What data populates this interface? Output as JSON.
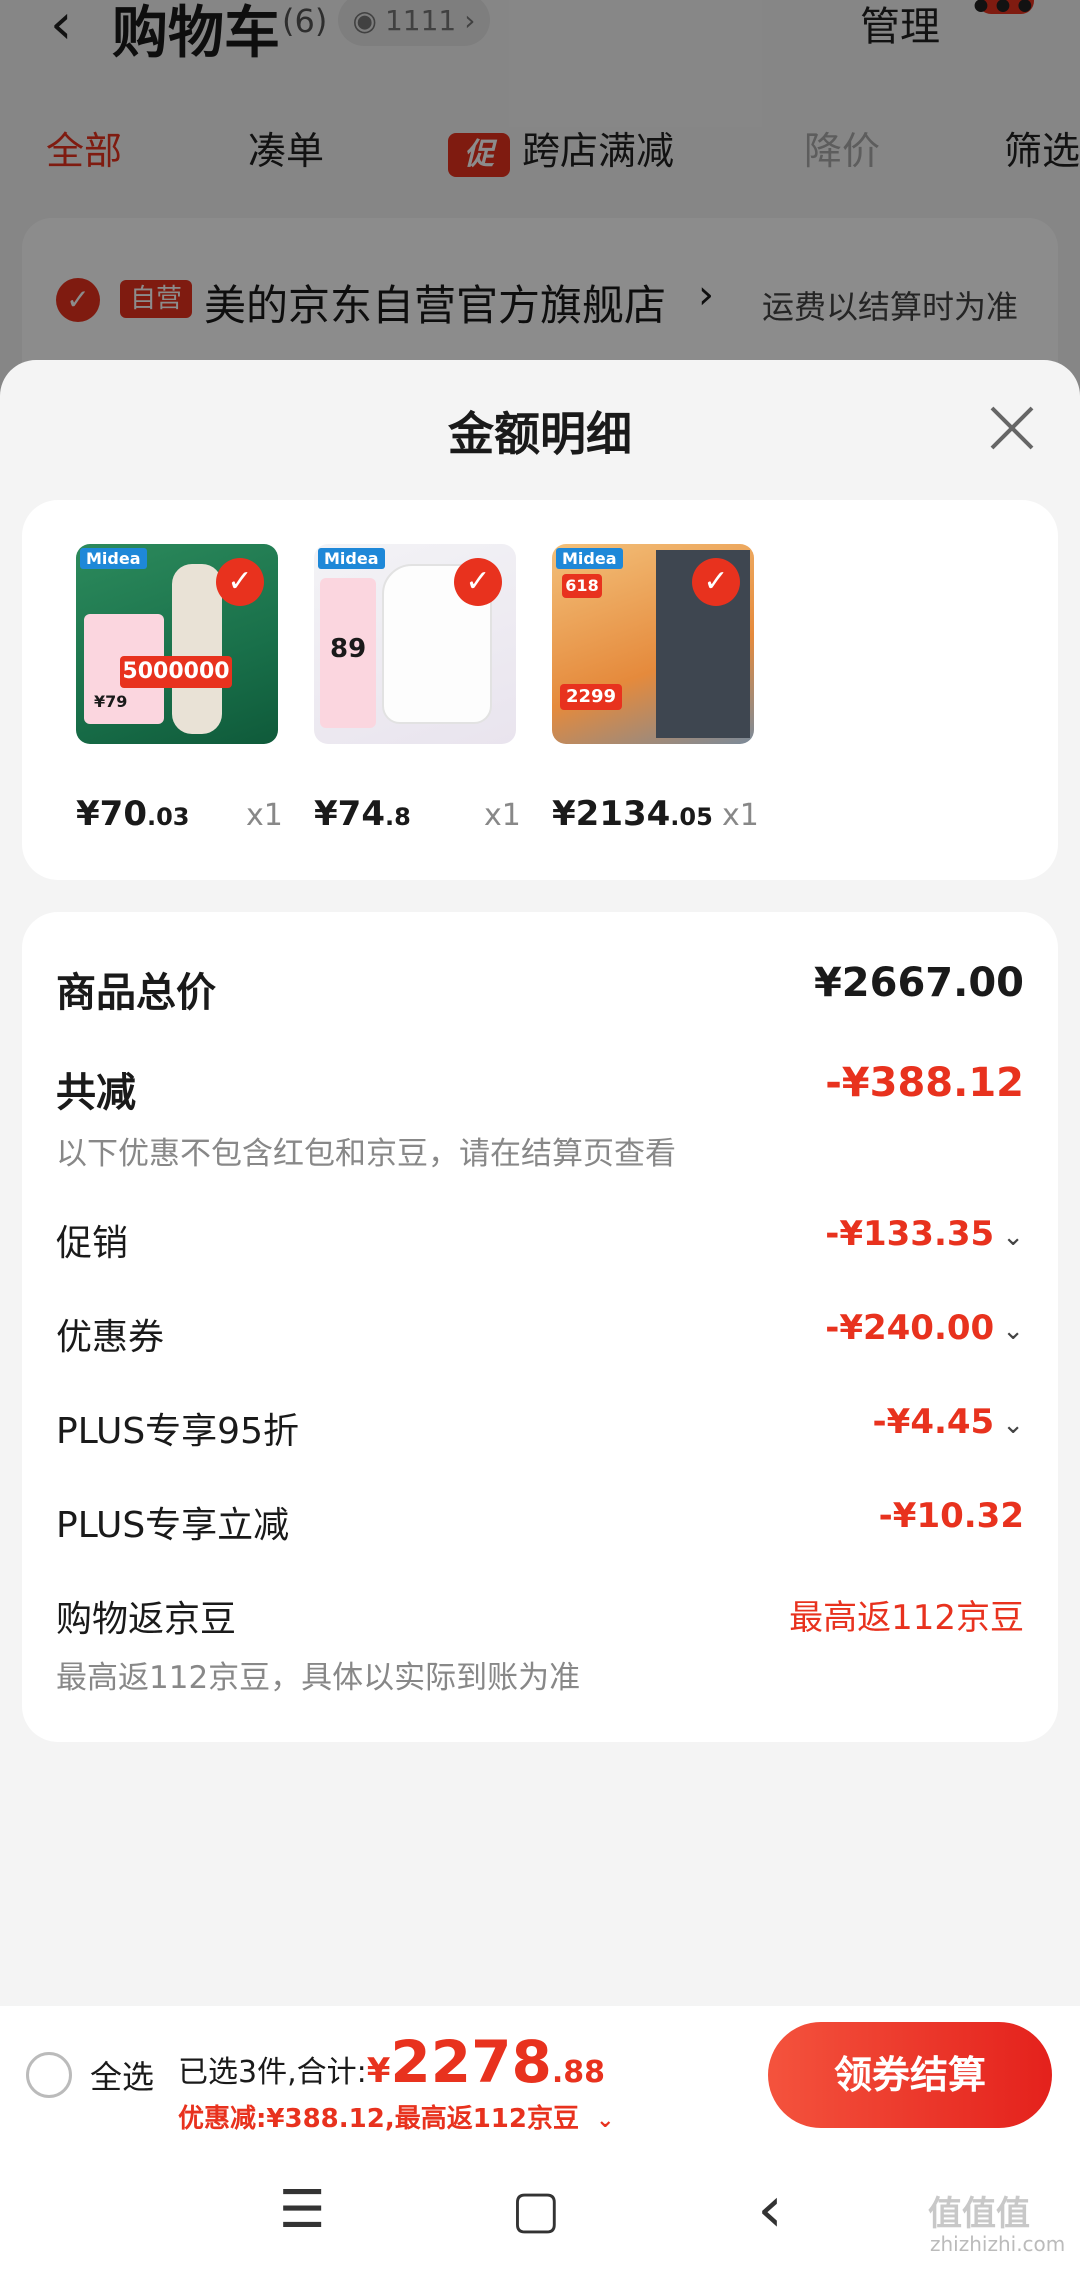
{
  "header": {
    "title": "购物车",
    "count": "(6)",
    "views": "1111",
    "manage": "管理"
  },
  "filters": {
    "all": "全部",
    "bundle": "凑单",
    "promo_tag": "促",
    "cross_store": "跨店满减",
    "price_drop": "降价",
    "filter": "筛选"
  },
  "store": {
    "tag": "自营",
    "name": "美的京东自营官方旗舰店",
    "shipping_note": "运费以结算时为准"
  },
  "sheet": {
    "title": "金额明细",
    "products": [
      {
        "price_int": "¥70",
        "price_dec": ".03",
        "qty": "x1"
      },
      {
        "price_int": "¥74",
        "price_dec": ".8",
        "qty": "x1"
      },
      {
        "price_int": "¥2134",
        "price_dec": ".05",
        "qty": "x1"
      }
    ],
    "product_images": {
      "brand": "Midea",
      "p1_badge": "5000000",
      "p1_price": "¥79",
      "p2_price": "89",
      "p3_price": "2299",
      "p3_tag": "618"
    },
    "total": {
      "label": "商品总价",
      "value": "¥2667.00"
    },
    "reduction": {
      "label": "共减",
      "value": "-¥388.12",
      "note": "以下优惠不包含红包和京豆，请在结算页查看"
    },
    "promo": {
      "label": "促销",
      "value": "-¥133.35"
    },
    "coupon": {
      "label": "优惠券",
      "value": "-¥240.00"
    },
    "plus_discount": {
      "label": "PLUS专享95折",
      "value": "-¥4.45"
    },
    "plus_cut": {
      "label": "PLUS专享立减",
      "value": "-¥10.32"
    },
    "beans": {
      "label": "购物返京豆",
      "value": "最高返112京豆",
      "note": "最高返112京豆，具体以实际到账为准"
    }
  },
  "bottom": {
    "select_all": "全选",
    "selected_text": "已选3件,合计:",
    "total_yen": "¥",
    "total_int": "2278",
    "total_dec": ".88",
    "discount_line": "优惠减:¥388.12,最高返112京豆",
    "checkout": "领券结算"
  },
  "nav": {
    "menu": "☰",
    "home": "▢",
    "back": "‹"
  },
  "watermark": {
    "main": "值值值",
    "sub": "zhizhizhi.com"
  },
  "colors": {
    "accent": "#e8321e"
  }
}
